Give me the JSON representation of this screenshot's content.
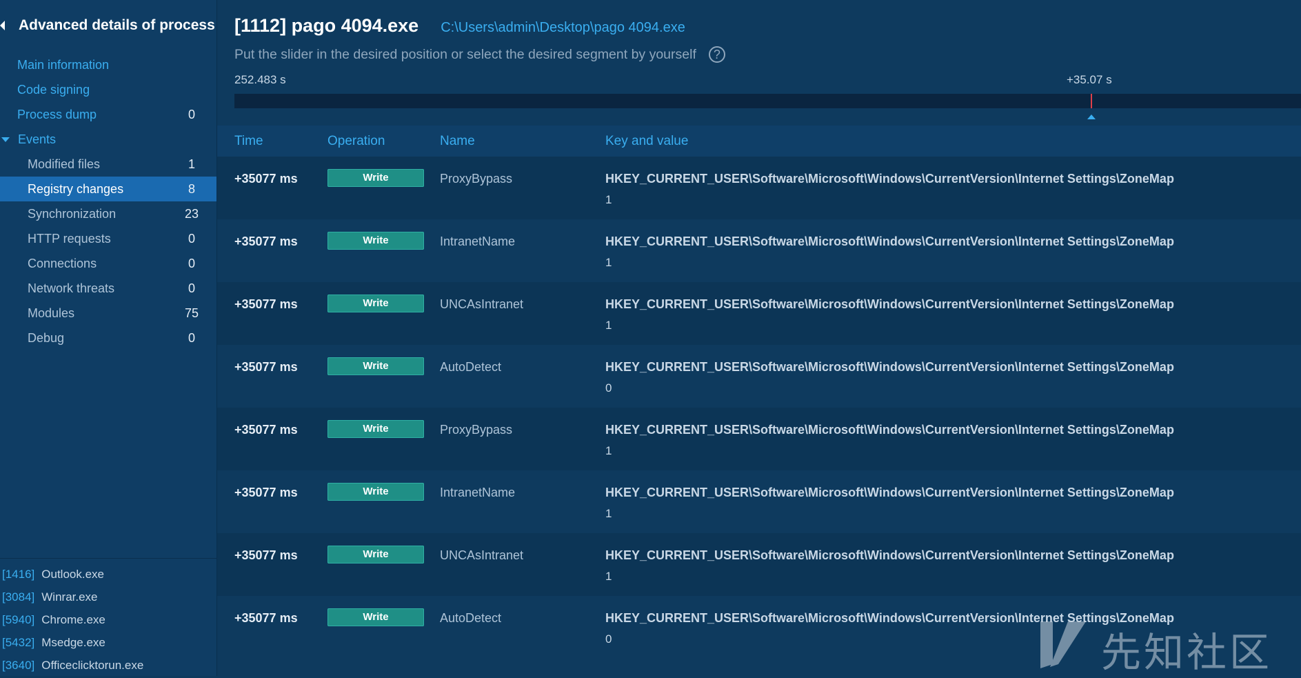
{
  "sidebar": {
    "title": "Advanced details of process",
    "items": [
      {
        "label": "Main information",
        "count": ""
      },
      {
        "label": "Code signing",
        "count": ""
      },
      {
        "label": "Process dump",
        "count": "0"
      },
      {
        "label": "Events",
        "count": ""
      },
      {
        "label": "Modified files",
        "count": "1"
      },
      {
        "label": "Registry changes",
        "count": "8"
      },
      {
        "label": "Synchronization",
        "count": "23"
      },
      {
        "label": "HTTP requests",
        "count": "0"
      },
      {
        "label": "Connections",
        "count": "0"
      },
      {
        "label": "Network threats",
        "count": "0"
      },
      {
        "label": "Modules",
        "count": "75"
      },
      {
        "label": "Debug",
        "count": "0"
      }
    ],
    "processes": [
      {
        "pid": "[1416]",
        "name": "Outlook.exe"
      },
      {
        "pid": "[3084]",
        "name": "Winrar.exe"
      },
      {
        "pid": "[5940]",
        "name": "Chrome.exe"
      },
      {
        "pid": "[5432]",
        "name": "Msedge.exe"
      },
      {
        "pid": "[3640]",
        "name": "Officeclicktorun.exe"
      }
    ]
  },
  "header": {
    "title": "[1112] pago 4094.exe",
    "path": "C:\\Users\\admin\\Desktop\\pago 4094.exe",
    "hint": "Put the slider in the desired position or select the desired segment by yourself",
    "help": "?"
  },
  "slider": {
    "duration_label": "252.483 s",
    "position_label": "+35.07 s",
    "position_fraction": 0.6724
  },
  "table": {
    "columns": [
      "Time",
      "Operation",
      "Name",
      "Key and value"
    ],
    "rows": [
      {
        "time": "+35077 ms",
        "operation": "Write",
        "name": "ProxyBypass",
        "key": "HKEY_CURRENT_USER\\Software\\Microsoft\\Windows\\CurrentVersion\\Internet Settings\\ZoneMap",
        "value": "1"
      },
      {
        "time": "+35077 ms",
        "operation": "Write",
        "name": "IntranetName",
        "key": "HKEY_CURRENT_USER\\Software\\Microsoft\\Windows\\CurrentVersion\\Internet Settings\\ZoneMap",
        "value": "1"
      },
      {
        "time": "+35077 ms",
        "operation": "Write",
        "name": "UNCAsIntranet",
        "key": "HKEY_CURRENT_USER\\Software\\Microsoft\\Windows\\CurrentVersion\\Internet Settings\\ZoneMap",
        "value": "1"
      },
      {
        "time": "+35077 ms",
        "operation": "Write",
        "name": "AutoDetect",
        "key": "HKEY_CURRENT_USER\\Software\\Microsoft\\Windows\\CurrentVersion\\Internet Settings\\ZoneMap",
        "value": "0"
      },
      {
        "time": "+35077 ms",
        "operation": "Write",
        "name": "ProxyBypass",
        "key": "HKEY_CURRENT_USER\\Software\\Microsoft\\Windows\\CurrentVersion\\Internet Settings\\ZoneMap",
        "value": "1"
      },
      {
        "time": "+35077 ms",
        "operation": "Write",
        "name": "IntranetName",
        "key": "HKEY_CURRENT_USER\\Software\\Microsoft\\Windows\\CurrentVersion\\Internet Settings\\ZoneMap",
        "value": "1"
      },
      {
        "time": "+35077 ms",
        "operation": "Write",
        "name": "UNCAsIntranet",
        "key": "HKEY_CURRENT_USER\\Software\\Microsoft\\Windows\\CurrentVersion\\Internet Settings\\ZoneMap",
        "value": "1"
      },
      {
        "time": "+35077 ms",
        "operation": "Write",
        "name": "AutoDetect",
        "key": "HKEY_CURRENT_USER\\Software\\Microsoft\\Windows\\CurrentVersion\\Internet Settings\\ZoneMap",
        "value": "0"
      }
    ]
  },
  "watermark": {
    "text": "先知社区"
  },
  "colors": {
    "accent": "#3aaef0",
    "active": "#1a6ab0",
    "write_badge": "#1f8f86",
    "marker": "#e0404a"
  }
}
